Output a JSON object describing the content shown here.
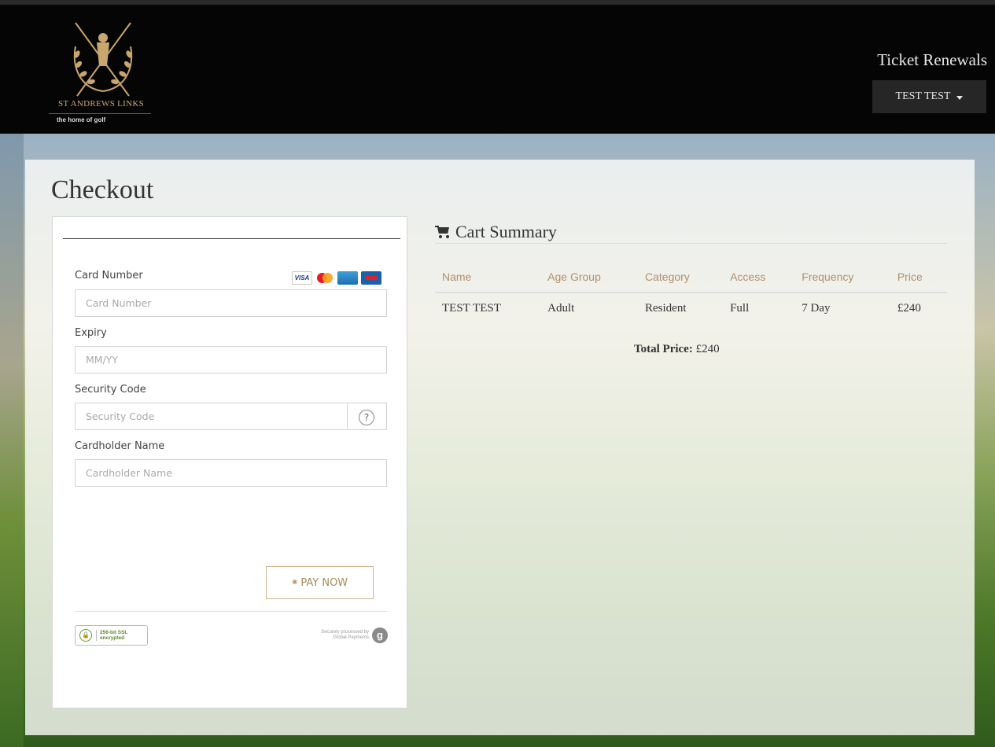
{
  "header": {
    "brand": "ST ANDREWS LINKS",
    "tagline": "the home of golf",
    "app_title": "Ticket Renewals",
    "user_menu": "TEST TEST"
  },
  "page": {
    "title": "Checkout"
  },
  "payment_form": {
    "card_number_label": "Card Number",
    "card_number_placeholder": "Card Number",
    "expiry_label": "Expiry",
    "expiry_placeholder": "MM/YY",
    "security_code_label": "Security Code",
    "security_code_placeholder": "Security Code",
    "security_help": "?",
    "cardholder_label": "Cardholder Name",
    "cardholder_placeholder": "Cardholder Name",
    "pay_button": "PAY NOW",
    "card_logos": [
      "visa-logo",
      "mastercard-logo",
      "amex-logo",
      "maestro-logo"
    ],
    "visa_text": "VISA",
    "ssl_badge": "256-bit SSL encrypted",
    "ssl_line1": "256-bit SSL",
    "ssl_line2": "encrypted",
    "processor_line1": "Securely processed by",
    "processor_line2": "Global Payments",
    "processor_logo": "g"
  },
  "cart": {
    "title": "Cart Summary",
    "columns": [
      "Name",
      "Age Group",
      "Category",
      "Access",
      "Frequency",
      "Price"
    ],
    "rows": [
      [
        "TEST TEST",
        "Adult",
        "Resident",
        "Full",
        "7 Day",
        "£240"
      ]
    ],
    "total_label": "Total Price:",
    "total_value": "£240"
  },
  "colors": {
    "header_bg": "#050505",
    "accent_gold": "#b0906a",
    "button_border": "#c9b48f"
  }
}
